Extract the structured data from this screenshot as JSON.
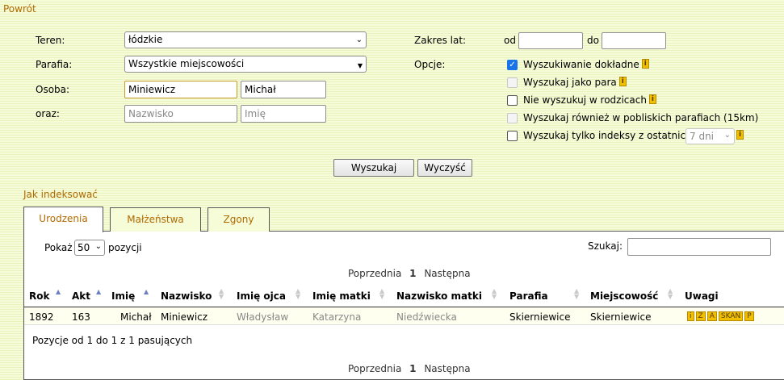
{
  "nav": {
    "back_link": "Powrót"
  },
  "form": {
    "teren_label": "Teren:",
    "teren_value": "łódzkie",
    "parafia_label": "Parafia:",
    "parafia_value": "Wszystkie miejscowości",
    "osoba_label": "Osoba:",
    "osoba_surname": "Miniewicz",
    "osoba_name": "Michał",
    "oraz_label": "oraz:",
    "oraz_surname_placeholder": "Nazwisko",
    "oraz_name_placeholder": "Imię",
    "years_label": "Zakres lat:",
    "years_from_label": "od",
    "years_from_value": "",
    "years_to_label": "do",
    "years_to_value": "",
    "options_label": "Opcje:",
    "options": [
      {
        "label": "Wyszukiwanie dokładne",
        "checked": true,
        "enabled": true
      },
      {
        "label": "Wyszukaj jako para",
        "checked": false,
        "enabled": false
      },
      {
        "label": "Nie wyszukuj w rodzicach",
        "checked": false,
        "enabled": true
      },
      {
        "label": "Wyszukaj również w pobliskich parafiach (15km)",
        "checked": false,
        "enabled": false
      },
      {
        "label": "Wyszukaj tylko indeksy z ostatnich",
        "checked": false,
        "enabled": true
      }
    ],
    "recent_select_value": "7 dni",
    "search_button": "Wyszukaj",
    "clear_button": "Wyczyść"
  },
  "how_to_index_link": "Jak indeksować",
  "tabs": [
    "Urodzenia",
    "Małżeństwa",
    "Zgony"
  ],
  "table_controls": {
    "show_label": "Pokaż",
    "show_value": "50",
    "entries_label": "pozycji",
    "search_label": "Szukaj:",
    "search_value": ""
  },
  "pagination": {
    "prev": "Poprzednia",
    "page": "1",
    "next": "Następna"
  },
  "columns": [
    "Rok",
    "Akt",
    "Imię",
    "Nazwisko",
    "Imię ojca",
    "Imię matki",
    "Nazwisko matki",
    "Parafia",
    "Miejscowość",
    "Uwagi"
  ],
  "rows": [
    {
      "rok": "1892",
      "akt": "163",
      "imie": "Michał",
      "nazwisko": "Miniewicz",
      "imie_ojca": "Władysław",
      "imie_matki": "Katarzyna",
      "nazwisko_matki": "Niedźwiecka",
      "parafia": "Skierniewice",
      "miejscowosc": "Skierniewice",
      "uwagi": [
        "i",
        "Z",
        "A",
        "SKAN",
        "P"
      ]
    }
  ],
  "table_info": "Pozycje od 1 do 1 z 1 pasujących",
  "colors": {
    "accent_orange": "#b06a00",
    "background": "#f6fbd8",
    "info_yellow": "#f0c000",
    "checkbox_blue": "#1a73e8"
  },
  "icons": [
    "info-icon",
    "chevron-down-icon",
    "sort-asc-icon",
    "sort-icon"
  ]
}
